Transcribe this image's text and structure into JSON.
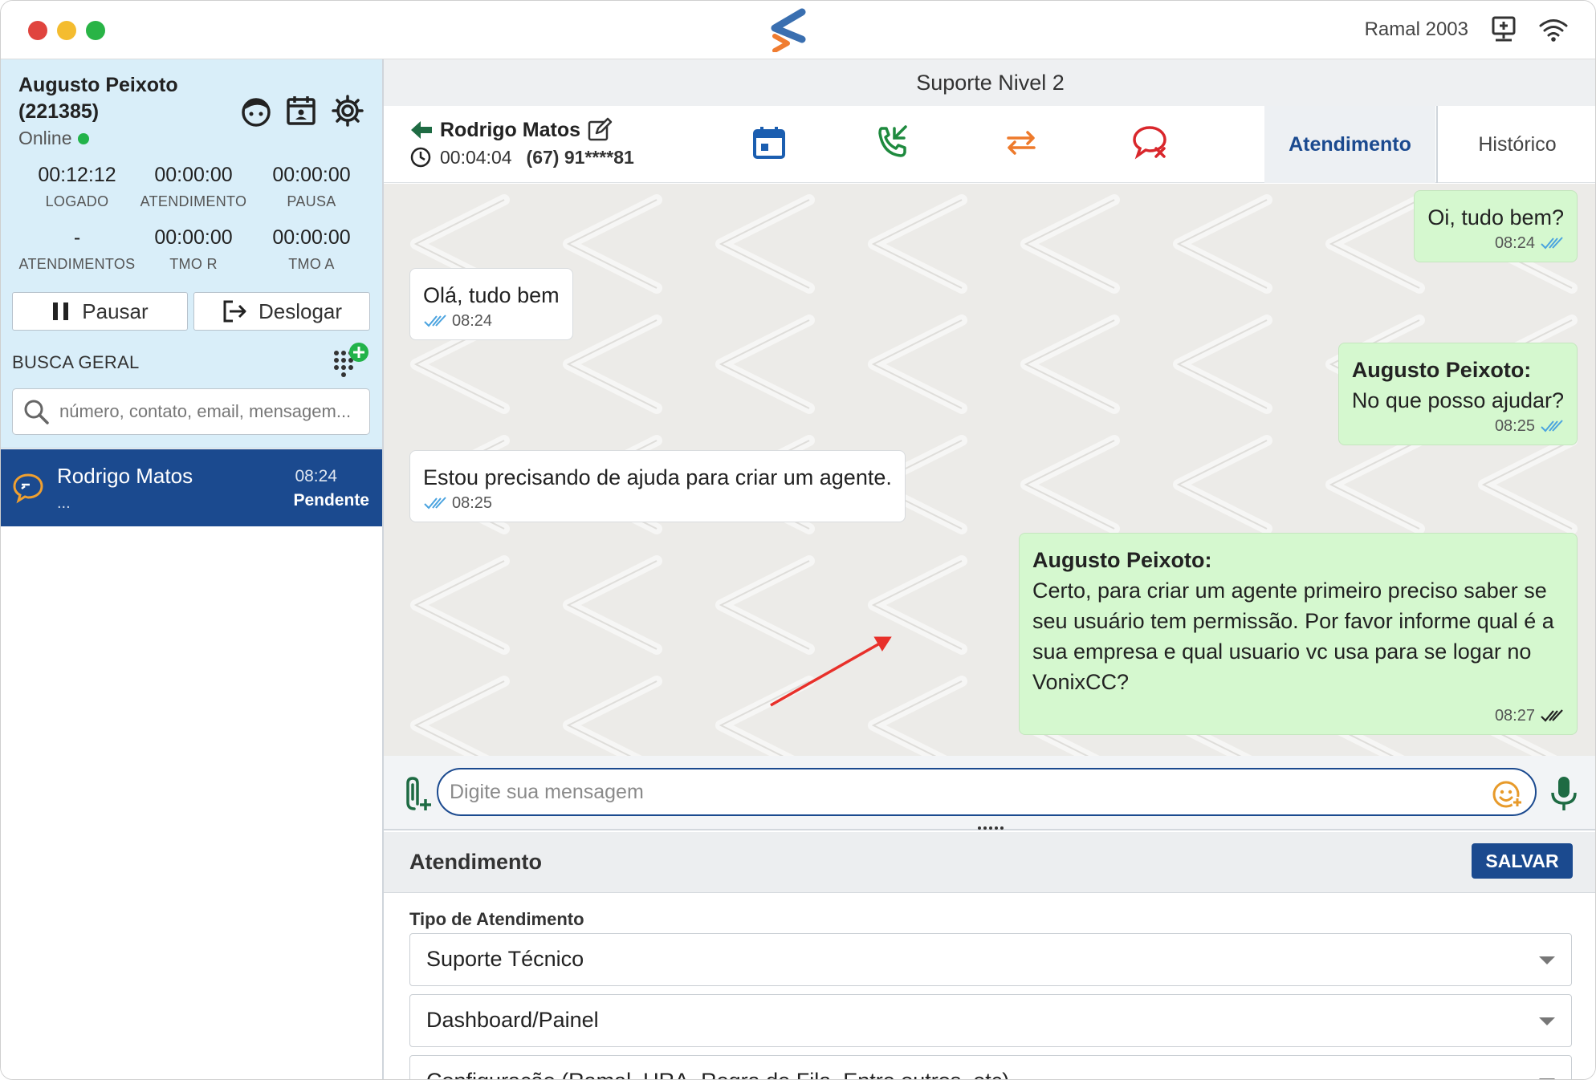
{
  "window": {
    "ramal": "Ramal 2003"
  },
  "agent": {
    "name": "Augusto Peixoto (221385)",
    "status": "Online",
    "stats": [
      {
        "value": "00:12:12",
        "label": "LOGADO"
      },
      {
        "value": "00:00:00",
        "label": "ATENDIMENTO"
      },
      {
        "value": "00:00:00",
        "label": "PAUSA"
      },
      {
        "value": "-",
        "label": "ATENDIMENTOS"
      },
      {
        "value": "00:00:00",
        "label": "TMO R"
      },
      {
        "value": "00:00:00",
        "label": "TMO A"
      }
    ],
    "pause_label": "Pausar",
    "logout_label": "Deslogar"
  },
  "search": {
    "label": "BUSCA GERAL",
    "placeholder": "número, contato, email, mensagem..."
  },
  "conversations": [
    {
      "name": "Rodrigo Matos",
      "preview": "...",
      "time": "08:24",
      "status": "Pendente"
    }
  ],
  "queue": {
    "name": "Suporte Nivel 2"
  },
  "contact": {
    "name": "Rodrigo Matos",
    "duration": "00:04:04",
    "phone": "(67) 91****81"
  },
  "tabs": {
    "active": "Atendimento",
    "other": "Histórico"
  },
  "messages": [
    {
      "direction": "out",
      "sender": "",
      "text": "Oi, tudo bem?",
      "time": "08:24"
    },
    {
      "direction": "in",
      "sender": "",
      "text": "Olá, tudo bem",
      "time": "08:24"
    },
    {
      "direction": "out",
      "sender": "Augusto Peixoto:",
      "text": "No que posso ajudar?",
      "time": "08:25"
    },
    {
      "direction": "in",
      "sender": "",
      "text": "Estou precisando de ajuda para criar um agente.",
      "time": "08:25"
    },
    {
      "direction": "out",
      "sender": "Augusto Peixoto:",
      "text": "Certo, para criar um agente primeiro preciso saber se seu usuário tem permissão. Por favor informe qual é a sua empresa e qual usuario vc usa para se logar no VonixCC?",
      "time": "08:27"
    }
  ],
  "composer": {
    "placeholder": "Digite sua mensagem"
  },
  "form": {
    "title": "Atendimento",
    "save_label": "SALVAR",
    "field_label": "Tipo de Atendimento",
    "selects": [
      "Suporte Técnico",
      "Dashboard/Painel",
      "Configuração (Ramal, URA, Regra de Fila, Entre outros, etc)"
    ]
  },
  "colors": {
    "brand": "#1b4a8f",
    "agent_panel": "#d9eef9",
    "bubble_out": "#d5f8cf",
    "online": "#22b34a",
    "annotation_arrow": "#e8302a"
  }
}
